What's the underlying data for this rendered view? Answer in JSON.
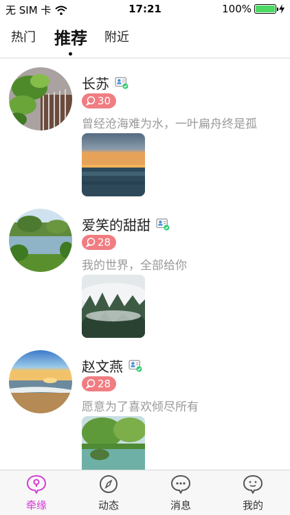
{
  "status_bar": {
    "carrier": "无 SIM 卡",
    "time": "17:21",
    "battery": "100%",
    "battery_level": 1.0
  },
  "top_tabs": [
    {
      "label": "热门",
      "active": false
    },
    {
      "label": "推荐",
      "active": true
    },
    {
      "label": "附近",
      "active": false
    }
  ],
  "feed": [
    {
      "name": "长苏",
      "likes": "30",
      "bio": "曾经沧海难为水，一叶扁舟终是孤"
    },
    {
      "name": "爱笑的甜甜",
      "likes": "28",
      "bio": "我的世界，全部给你"
    },
    {
      "name": "赵文燕",
      "likes": "28",
      "bio": "愿意为了喜欢倾尽所有"
    }
  ],
  "bottom_nav": [
    {
      "label": "牵缘",
      "icon": "location-bubble-icon",
      "active": true
    },
    {
      "label": "动态",
      "icon": "compass-icon",
      "active": false
    },
    {
      "label": "消息",
      "icon": "chat-bubble-icon",
      "active": false
    },
    {
      "label": "我的",
      "icon": "face-icon",
      "active": false
    }
  ],
  "colors": {
    "accent": "#d43bd4",
    "badge": "#f07d82",
    "verified": "#2ecc71"
  }
}
